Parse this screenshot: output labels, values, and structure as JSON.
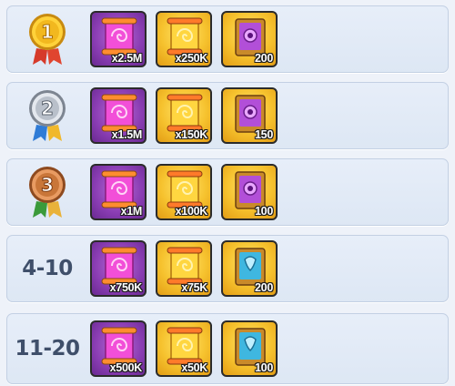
{
  "rewards_table": {
    "rows": [
      {
        "rank_icon": "gold-medal-icon",
        "rank_label": "1",
        "items": [
          {
            "icon": "pink-scroll-icon",
            "qty": "x2.5M"
          },
          {
            "icon": "gold-scroll-icon",
            "qty": "x250K"
          },
          {
            "icon": "purple-book-icon",
            "qty": "200"
          }
        ]
      },
      {
        "rank_icon": "silver-medal-icon",
        "rank_label": "2",
        "items": [
          {
            "icon": "pink-scroll-icon",
            "qty": "x1.5M"
          },
          {
            "icon": "gold-scroll-icon",
            "qty": "x150K"
          },
          {
            "icon": "purple-book-icon",
            "qty": "150"
          }
        ]
      },
      {
        "rank_icon": "bronze-medal-icon",
        "rank_label": "3",
        "items": [
          {
            "icon": "pink-scroll-icon",
            "qty": "x1M"
          },
          {
            "icon": "gold-scroll-icon",
            "qty": "x100K"
          },
          {
            "icon": "purple-book-icon",
            "qty": "100"
          }
        ]
      },
      {
        "rank_text": "4-10",
        "items": [
          {
            "icon": "pink-scroll-icon",
            "qty": "x750K"
          },
          {
            "icon": "gold-scroll-icon",
            "qty": "x75K"
          },
          {
            "icon": "blue-book-icon",
            "qty": "200"
          }
        ]
      },
      {
        "rank_text": "11-20",
        "items": [
          {
            "icon": "pink-scroll-icon",
            "qty": "x500K"
          },
          {
            "icon": "gold-scroll-icon",
            "qty": "x50K"
          },
          {
            "icon": "blue-book-icon",
            "qty": "100"
          }
        ]
      }
    ]
  },
  "colors": {
    "row_background": "#e3ebf7",
    "rank_text": "#3f4f6a",
    "purple_tile": "#8a3db3",
    "gold_tile": "#f6c22e"
  }
}
